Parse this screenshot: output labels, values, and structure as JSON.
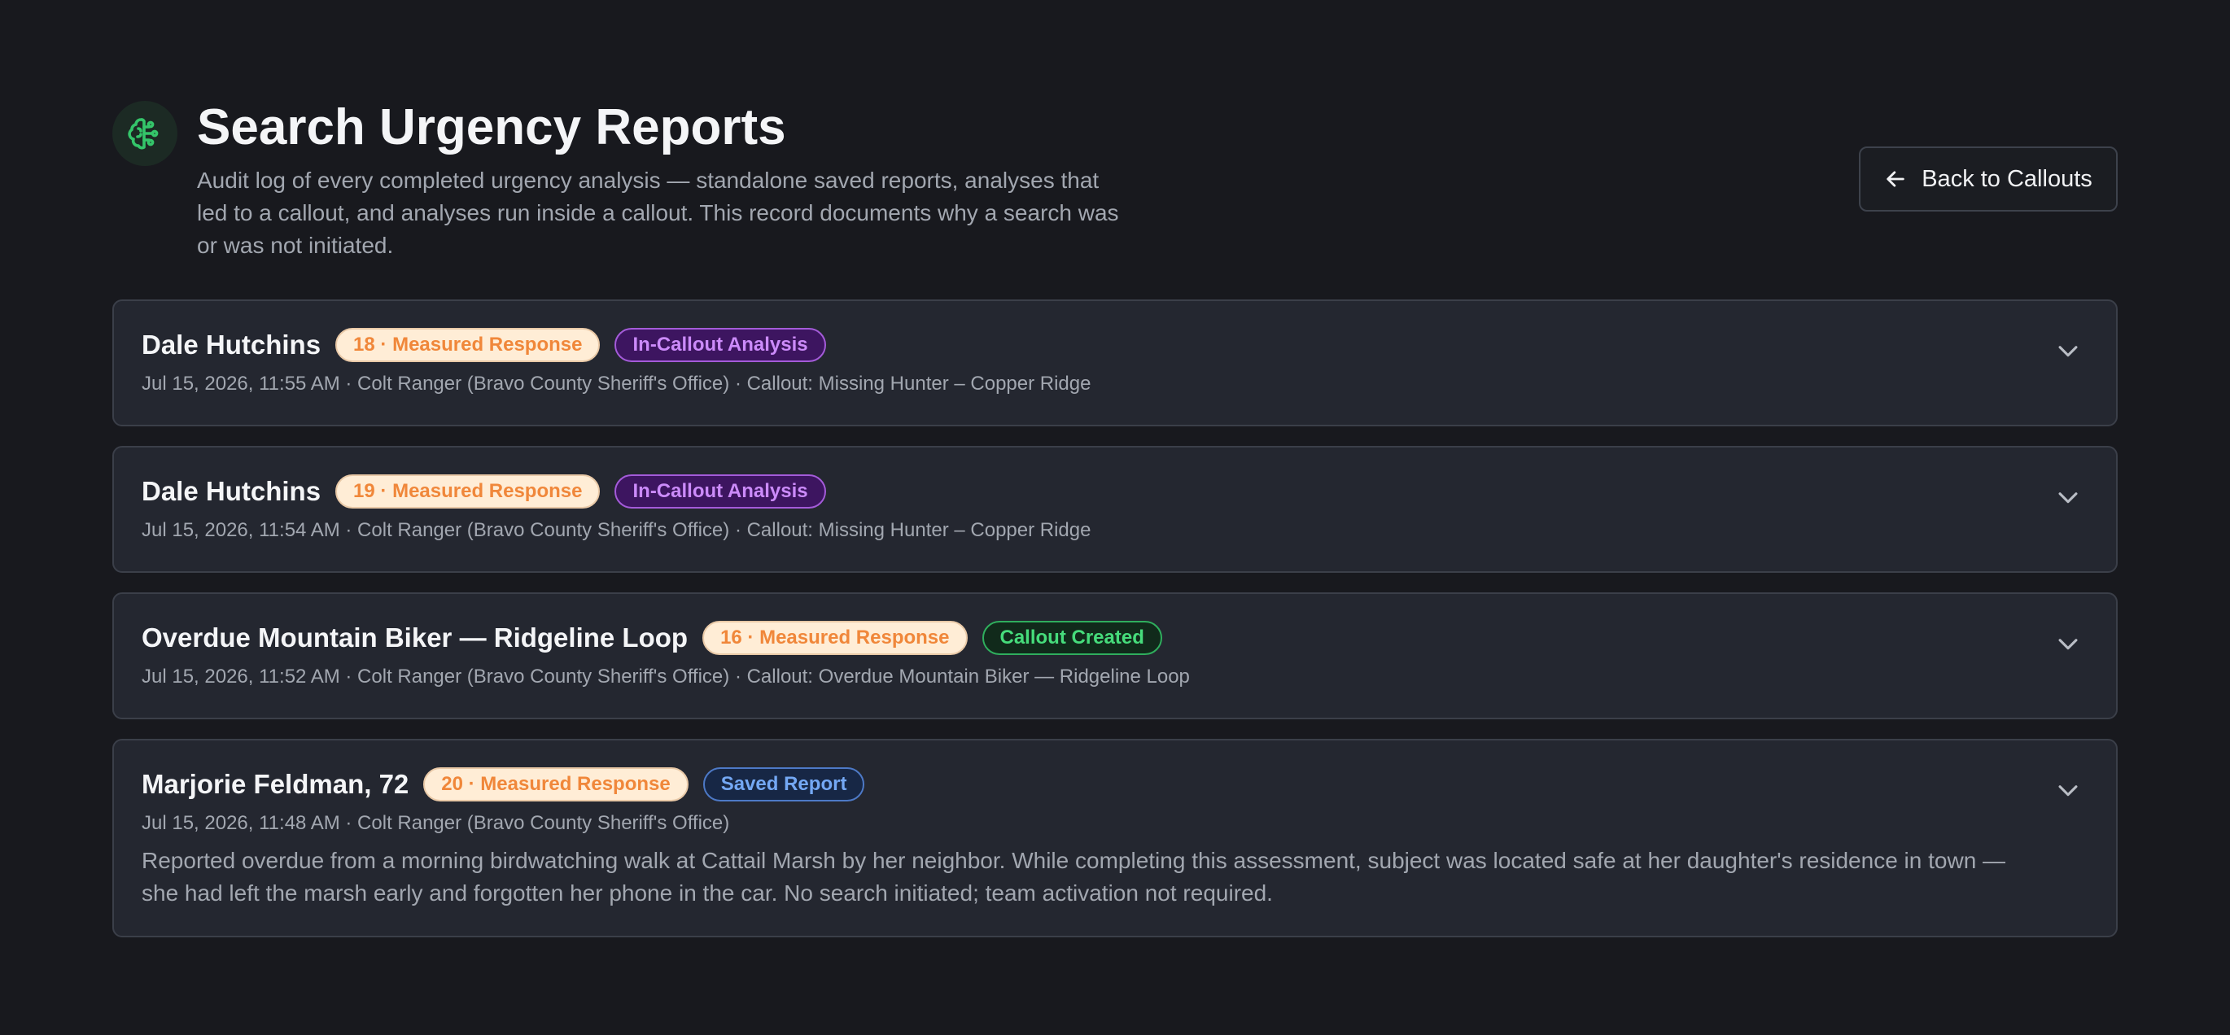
{
  "header": {
    "title": "Search Urgency Reports",
    "subtitle": "Audit log of every completed urgency analysis — standalone saved reports, analyses that led to a callout, and analyses run inside a callout. This record documents why a search was or was not initiated.",
    "logo_icon": "brain-icon",
    "accent_color": "#34c56a"
  },
  "back_button": {
    "label": "Back to Callouts",
    "icon": "arrow-left-icon"
  },
  "reports": [
    {
      "name": "Dale Hutchins",
      "urgency": "18 · Measured Response",
      "type_label": "In-Callout Analysis",
      "meta": "Jul 15, 2026, 11:55 AM · Colt Ranger (Bravo County Sheriff's Office) · Callout: Missing Hunter – Copper Ridge",
      "description": ""
    },
    {
      "name": "Dale Hutchins",
      "urgency": "19 · Measured Response",
      "type_label": "In-Callout Analysis",
      "meta": "Jul 15, 2026, 11:54 AM · Colt Ranger (Bravo County Sheriff's Office) · Callout: Missing Hunter – Copper Ridge",
      "description": ""
    },
    {
      "name": "Overdue Mountain Biker — Ridgeline Loop",
      "urgency": "16 · Measured Response",
      "type_label": "Callout Created",
      "meta": "Jul 15, 2026, 11:52 AM · Colt Ranger (Bravo County Sheriff's Office) · Callout: Overdue Mountain Biker — Ridgeline Loop",
      "description": ""
    },
    {
      "name": "Marjorie Feldman, 72",
      "urgency": "20 · Measured Response",
      "type_label": "Saved Report",
      "meta": "Jul 15, 2026, 11:48 AM · Colt Ranger (Bravo County Sheriff's Office)",
      "description": "Reported overdue from a morning birdwatching walk at Cattail Marsh by her neighbor. While completing this assessment, subject was located safe at her daughter's residence in town — she had left the marsh early and forgotten her phone in the car. No search initiated; team activation not required."
    }
  ]
}
